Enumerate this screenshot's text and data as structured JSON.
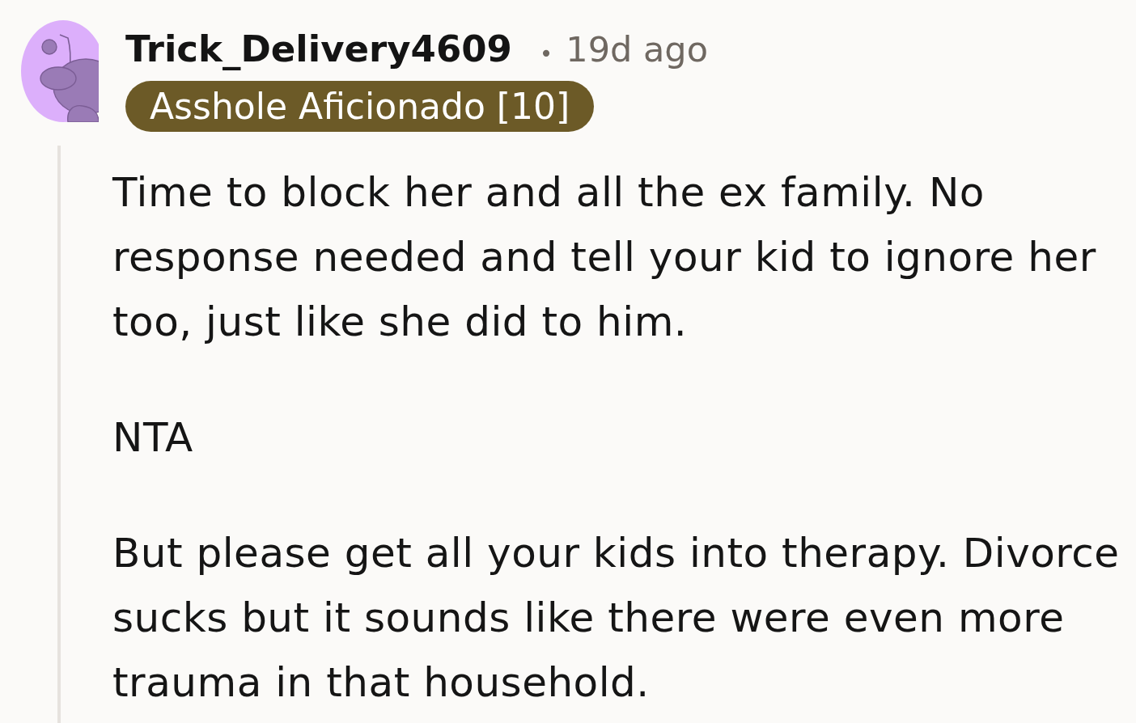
{
  "comment": {
    "author": "Trick_Delivery4609",
    "separator": "•",
    "time": "19d ago",
    "flair": "Asshole Aficionado [10]",
    "paragraphs": [
      "Time to block her and all the ex family. No response needed and tell your kid to ignore her too, just like she did to him.",
      "NTA",
      "But please get all your kids into therapy. Divorce sucks but it sounds like there were even more trauma in that household."
    ]
  }
}
